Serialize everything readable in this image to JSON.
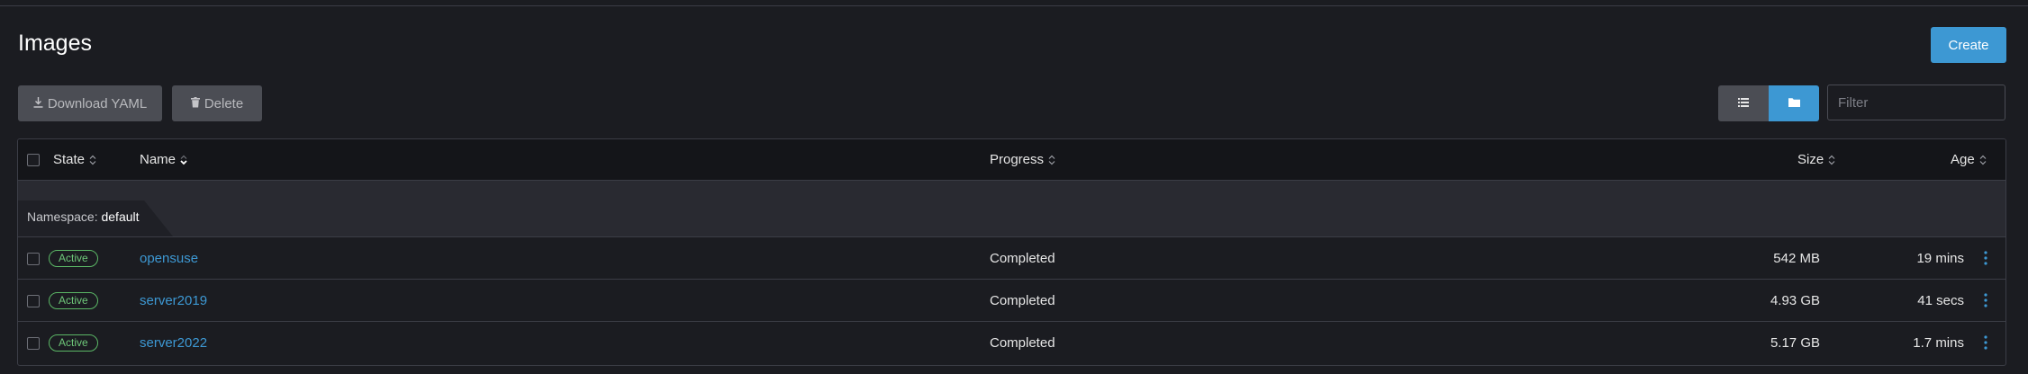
{
  "header": {
    "title": "Images",
    "create_label": "Create"
  },
  "toolbar": {
    "download_label": "Download YAML",
    "delete_label": "Delete",
    "filter_placeholder": "Filter"
  },
  "colors": {
    "accent": "#3d98d3",
    "status_active": "#6fc87a",
    "background": "#1b1c21"
  },
  "table": {
    "columns": {
      "state": "State",
      "name": "Name",
      "progress": "Progress",
      "size": "Size",
      "age": "Age"
    },
    "group": {
      "prefix": "Namespace: ",
      "value": "default"
    },
    "rows": [
      {
        "state": "Active",
        "name": "opensuse",
        "progress": "Completed",
        "size": "542 MB",
        "age": "19 mins"
      },
      {
        "state": "Active",
        "name": "server2019",
        "progress": "Completed",
        "size": "4.93 GB",
        "age": "41 secs"
      },
      {
        "state": "Active",
        "name": "server2022",
        "progress": "Completed",
        "size": "5.17 GB",
        "age": "1.7 mins"
      }
    ]
  }
}
